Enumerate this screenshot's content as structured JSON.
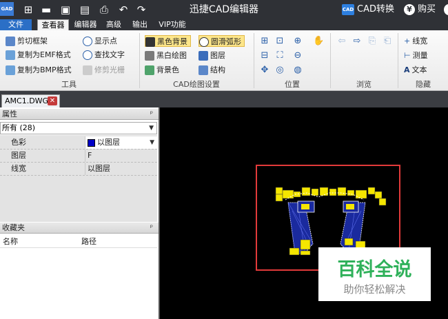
{
  "app": {
    "title": "迅捷CAD编辑器",
    "logo_text": "GAD",
    "cad_convert": "CAD转换",
    "cad_badge": "CAD",
    "buy": "购买",
    "yen": "¥"
  },
  "menubar": {
    "file": "文件",
    "tabs": [
      "查看器",
      "编辑器",
      "高级",
      "输出",
      "VIP功能"
    ],
    "active": "查看器"
  },
  "ribbon": {
    "tools": {
      "label": "工具",
      "items": [
        "剪切框架",
        "复制为EMF格式",
        "复制为BMP格式",
        "显示点",
        "查找文字",
        "修剪光栅"
      ]
    },
    "cad_settings": {
      "label": "CAD绘图设置",
      "items": [
        "黑色背景",
        "黑白绘图",
        "背景色",
        "圆滑弧形",
        "图层",
        "结构"
      ]
    },
    "position": {
      "label": "位置"
    },
    "browse": {
      "label": "浏览"
    },
    "hide": {
      "label": "隐藏",
      "items": [
        "线宽",
        "测量",
        "文本"
      ]
    }
  },
  "doc_tab": {
    "label": "AMC1.DWG"
  },
  "properties": {
    "header": "属性",
    "pin": "ᵖ",
    "selector": "所有 (28)",
    "rows": [
      {
        "name": "色彩",
        "value": "以图层"
      },
      {
        "name": "图层",
        "value": "F"
      },
      {
        "name": "线宽",
        "value": "以图层"
      }
    ]
  },
  "favorites": {
    "header": "收藏夹",
    "columns": [
      "名称",
      "路径"
    ]
  },
  "watermark": {
    "main": "百科全说",
    "sub": "助你轻松解决"
  },
  "colors": {
    "accent": "#2b6fc6",
    "frame_red": "#e23a3a",
    "pcb_yellow": "#f5e600",
    "pcb_blue": "#1a2a9e"
  }
}
